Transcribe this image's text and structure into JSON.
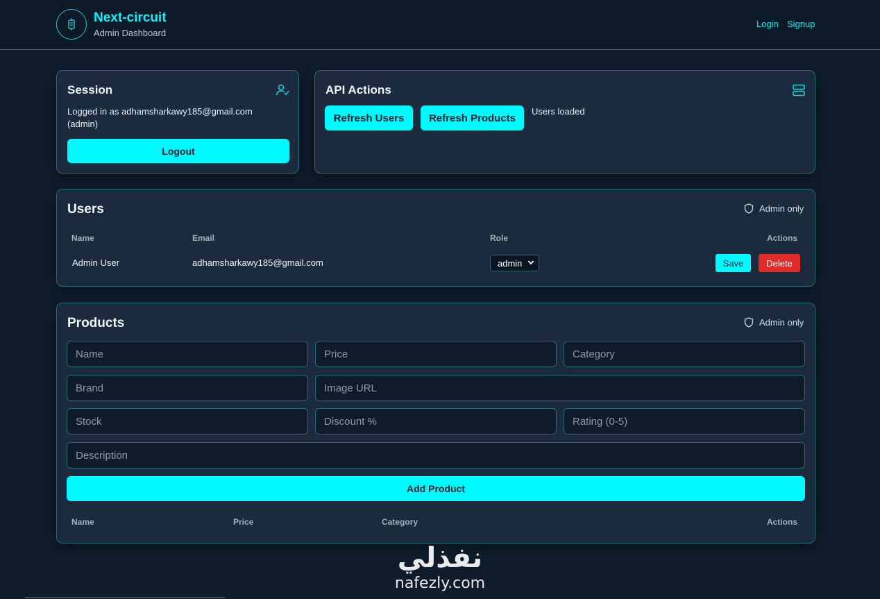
{
  "header": {
    "title": "Next-circuit",
    "subtitle": "Admin Dashboard",
    "nav": {
      "login": "Login",
      "signup": "Signup"
    }
  },
  "session": {
    "title": "Session",
    "logged_in_line1": "Logged in as adhamsharkawy185@gmail.com",
    "logged_in_line2": "(admin)",
    "logout_label": "Logout"
  },
  "api_actions": {
    "title": "API Actions",
    "refresh_users_label": "Refresh Users",
    "refresh_products_label": "Refresh Products",
    "status": "Users loaded"
  },
  "users": {
    "title": "Users",
    "badge": "Admin only",
    "columns": {
      "name": "Name",
      "email": "Email",
      "role": "Role",
      "actions": "Actions"
    },
    "rows": [
      {
        "name": "Admin User",
        "email": "adhamsharkawy185@gmail.com",
        "role": "admin",
        "save": "Save",
        "delete": "Delete"
      }
    ]
  },
  "products": {
    "title": "Products",
    "badge": "Admin only",
    "placeholders": {
      "name": "Name",
      "price": "Price",
      "category": "Category",
      "brand": "Brand",
      "image_url": "Image URL",
      "stock": "Stock",
      "discount": "Discount %",
      "rating": "Rating (0-5)",
      "description": "Description"
    },
    "add_label": "Add Product",
    "columns": {
      "name": "Name",
      "price": "Price",
      "category": "Category",
      "actions": "Actions"
    }
  },
  "watermark": {
    "arabic": "نفذلي",
    "latin": "nafezly.com"
  },
  "colors": {
    "accent": "#00f9ff",
    "danger": "#e32b2b",
    "card": "#1b2b3d",
    "background": "#0f1c2b"
  }
}
